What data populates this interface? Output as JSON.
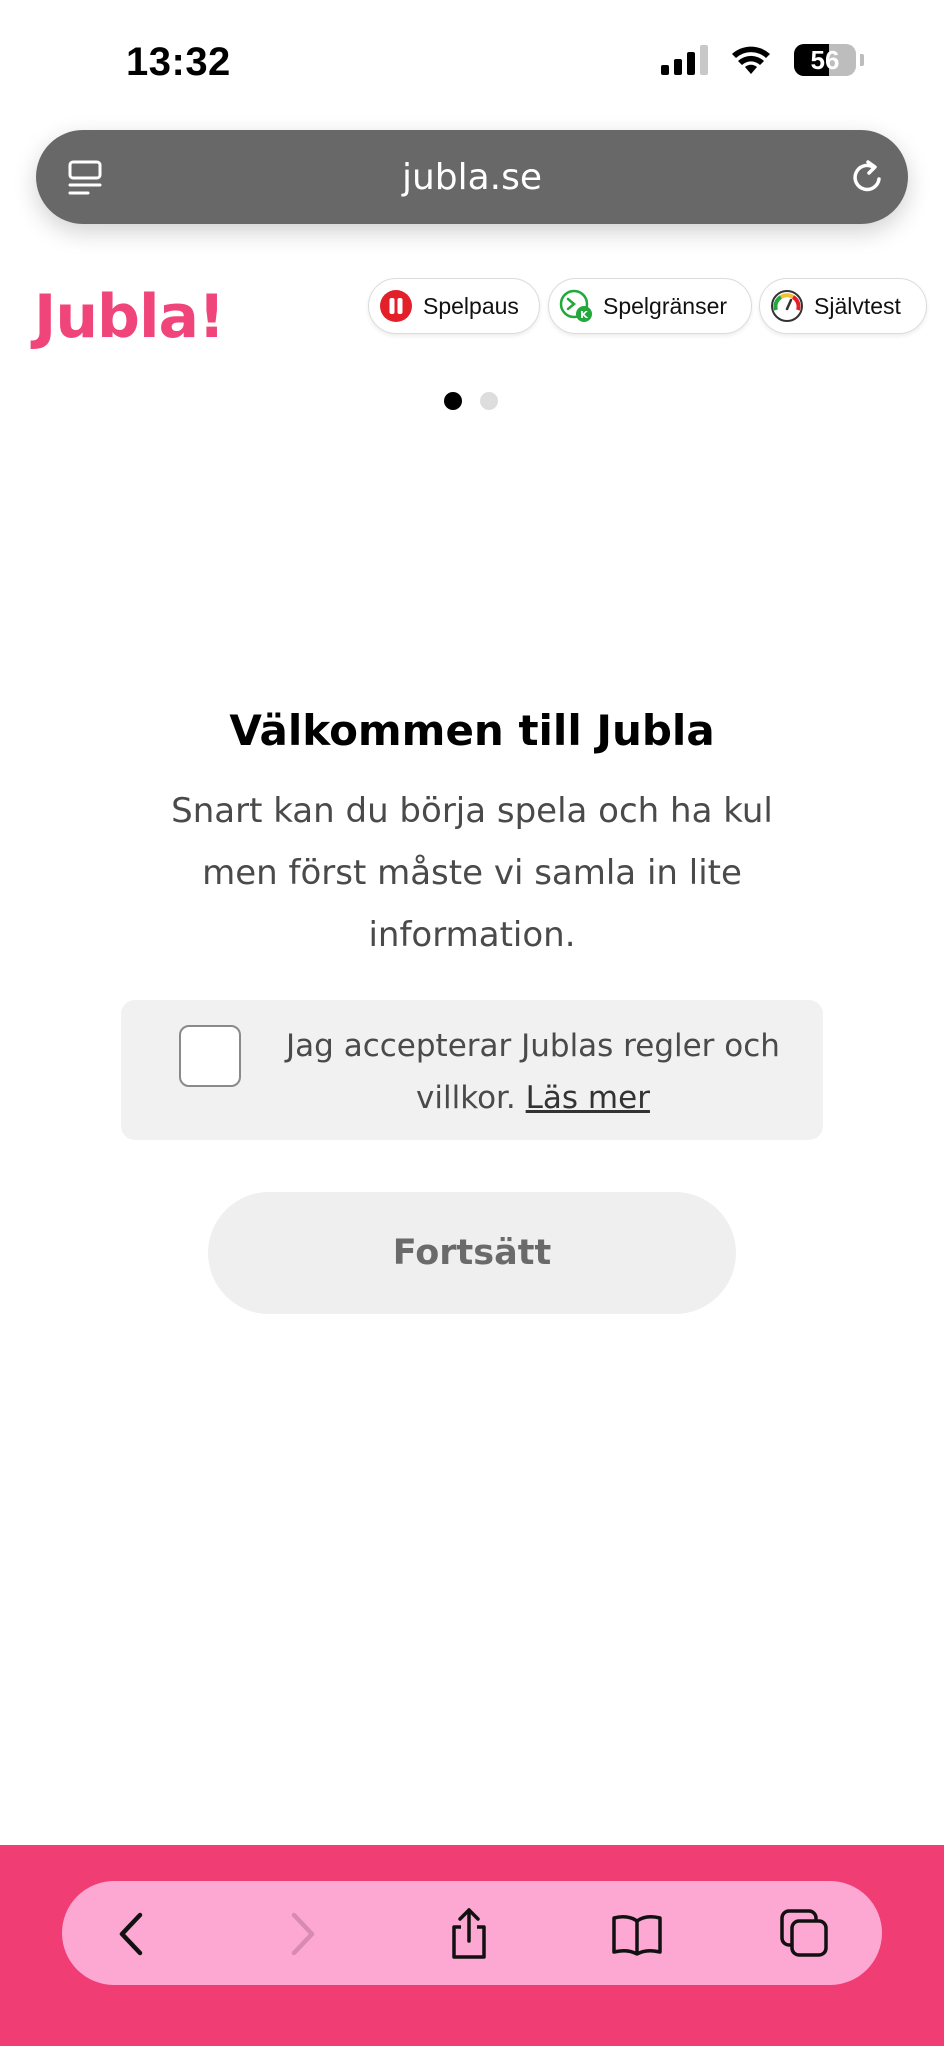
{
  "status": {
    "time": "13:32",
    "battery": "56"
  },
  "browser": {
    "url": "jubla.se"
  },
  "header": {
    "logo": "Jubla!",
    "pills": [
      {
        "label": "Spelpaus",
        "icon": "pause-icon",
        "color": "#e3202a"
      },
      {
        "label": "Spelgränser",
        "icon": "limits-icon",
        "color": "#22a83b"
      },
      {
        "label": "Självtest",
        "icon": "gauge-icon",
        "color": "#f1c232"
      }
    ]
  },
  "carousel": {
    "total": 2,
    "active": 1
  },
  "main": {
    "title": "Välkommen till Jubla",
    "text": "Snart kan du börja spela och ha kul men först måste vi samla in lite information.",
    "accept_text": "Jag accepterar Jublas regler och villkor.",
    "accept_link": "Läs mer",
    "accept_checked": false,
    "continue_label": "Fortsätt"
  },
  "colors": {
    "brand": "#f0457a",
    "bottom_bar": "#f03e74",
    "toolbar_pill": "#fca8d2",
    "url_bar": "#686868"
  }
}
